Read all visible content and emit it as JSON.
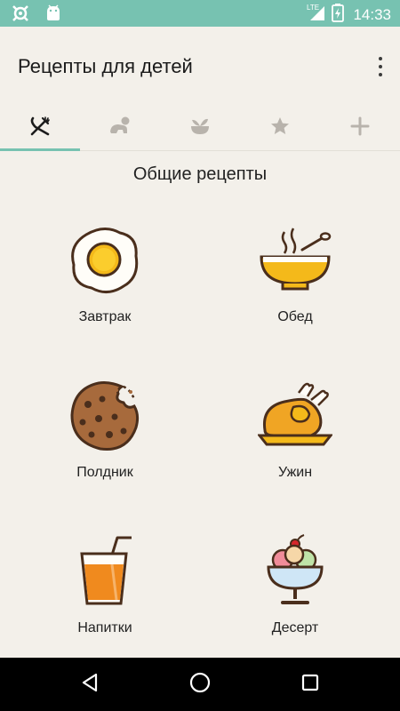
{
  "status_bar": {
    "time": "14:33",
    "network": "LTE"
  },
  "app_bar": {
    "title": "Рецепты для детей"
  },
  "tabs": [
    {
      "icon": "fork-knife-icon",
      "selected": true
    },
    {
      "icon": "baby-crawl-icon",
      "selected": false
    },
    {
      "icon": "sprout-bowl-icon",
      "selected": false
    },
    {
      "icon": "star-icon",
      "selected": false
    },
    {
      "icon": "plus-icon",
      "selected": false
    }
  ],
  "section_title": "Общие рецепты",
  "categories": [
    {
      "label": "Завтрак",
      "icon": "fried-egg-icon"
    },
    {
      "label": "Обед",
      "icon": "soup-bowl-icon"
    },
    {
      "label": "Полдник",
      "icon": "cookie-icon"
    },
    {
      "label": "Ужин",
      "icon": "roast-chicken-icon"
    },
    {
      "label": "Напитки",
      "icon": "juice-glass-icon"
    },
    {
      "label": "Десерт",
      "icon": "ice-cream-icon"
    }
  ],
  "colors": {
    "accent": "#77c2b1",
    "background": "#f3f0ea",
    "icon_stroke": "#4a2e1c"
  }
}
